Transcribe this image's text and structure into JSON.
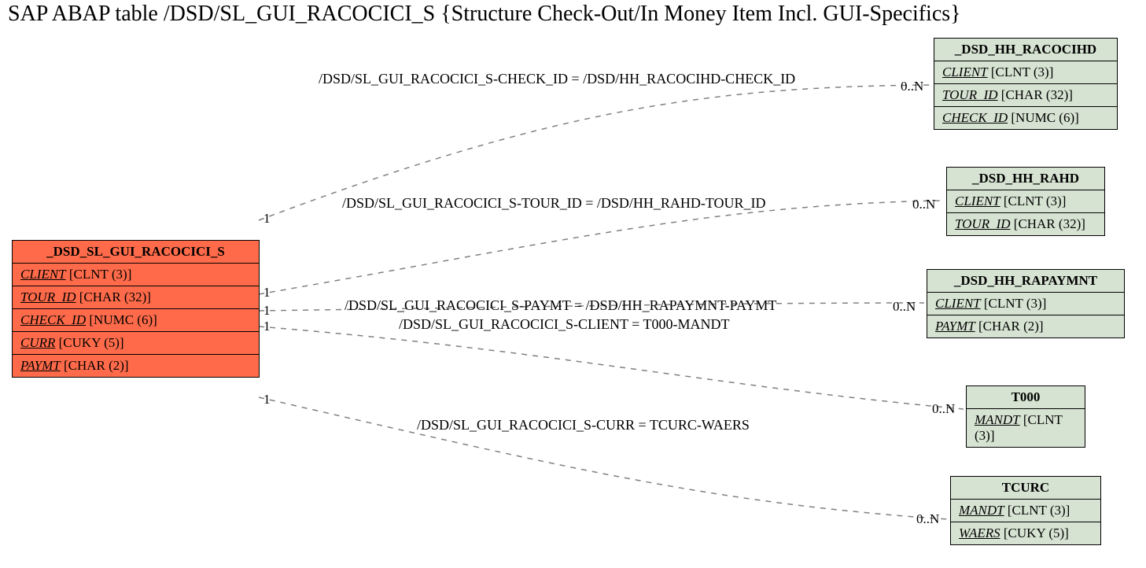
{
  "title": "SAP ABAP table /DSD/SL_GUI_RACOCICI_S {Structure Check-Out/In Money Item Incl. GUI-Specifics}",
  "main_entity": {
    "name": "_DSD_SL_GUI_RACOCICI_S",
    "fields": [
      {
        "key": "CLIENT",
        "type": "[CLNT (3)]"
      },
      {
        "key": "TOUR_ID",
        "type": "[CHAR (32)]"
      },
      {
        "key": "CHECK_ID",
        "type": "[NUMC (6)]"
      },
      {
        "key": "CURR",
        "type": "[CUKY (5)]"
      },
      {
        "key": "PAYMT",
        "type": "[CHAR (2)]"
      }
    ]
  },
  "related": [
    {
      "name": "_DSD_HH_RACOCIHD",
      "fields": [
        {
          "key": "CLIENT",
          "type": "[CLNT (3)]"
        },
        {
          "key": "TOUR_ID",
          "type": "[CHAR (32)]"
        },
        {
          "key": "CHECK_ID",
          "type": "[NUMC (6)]"
        }
      ]
    },
    {
      "name": "_DSD_HH_RAHD",
      "fields": [
        {
          "key": "CLIENT",
          "type": "[CLNT (3)]"
        },
        {
          "key": "TOUR_ID",
          "type": "[CHAR (32)]"
        }
      ]
    },
    {
      "name": "_DSD_HH_RAPAYMNT",
      "fields": [
        {
          "key": "CLIENT",
          "type": "[CLNT (3)]"
        },
        {
          "key": "PAYMT",
          "type": "[CHAR (2)]"
        }
      ]
    },
    {
      "name": "T000",
      "fields": [
        {
          "key": "MANDT",
          "type": "[CLNT (3)]"
        }
      ]
    },
    {
      "name": "TCURC",
      "fields": [
        {
          "key": "MANDT",
          "type": "[CLNT (3)]"
        },
        {
          "key": "WAERS",
          "type": "[CUKY (5)]"
        }
      ]
    }
  ],
  "relations": [
    {
      "label": "/DSD/SL_GUI_RACOCICI_S-CHECK_ID = /DSD/HH_RACOCIHD-CHECK_ID",
      "left_card": "1",
      "right_card": "0..N"
    },
    {
      "label": "/DSD/SL_GUI_RACOCICI_S-TOUR_ID = /DSD/HH_RAHD-TOUR_ID",
      "left_card": "1",
      "right_card": "0..N"
    },
    {
      "label": "/DSD/SL_GUI_RACOCICI_S-PAYMT = /DSD/HH_RAPAYMNT-PAYMT",
      "left_card": "1",
      "right_card": "0..N"
    },
    {
      "label": "/DSD/SL_GUI_RACOCICI_S-CLIENT = T000-MANDT",
      "left_card": "1",
      "right_card": "0..N"
    },
    {
      "label": "/DSD/SL_GUI_RACOCICI_S-CURR = TCURC-WAERS",
      "left_card": "1",
      "right_card": "0..N"
    }
  ]
}
